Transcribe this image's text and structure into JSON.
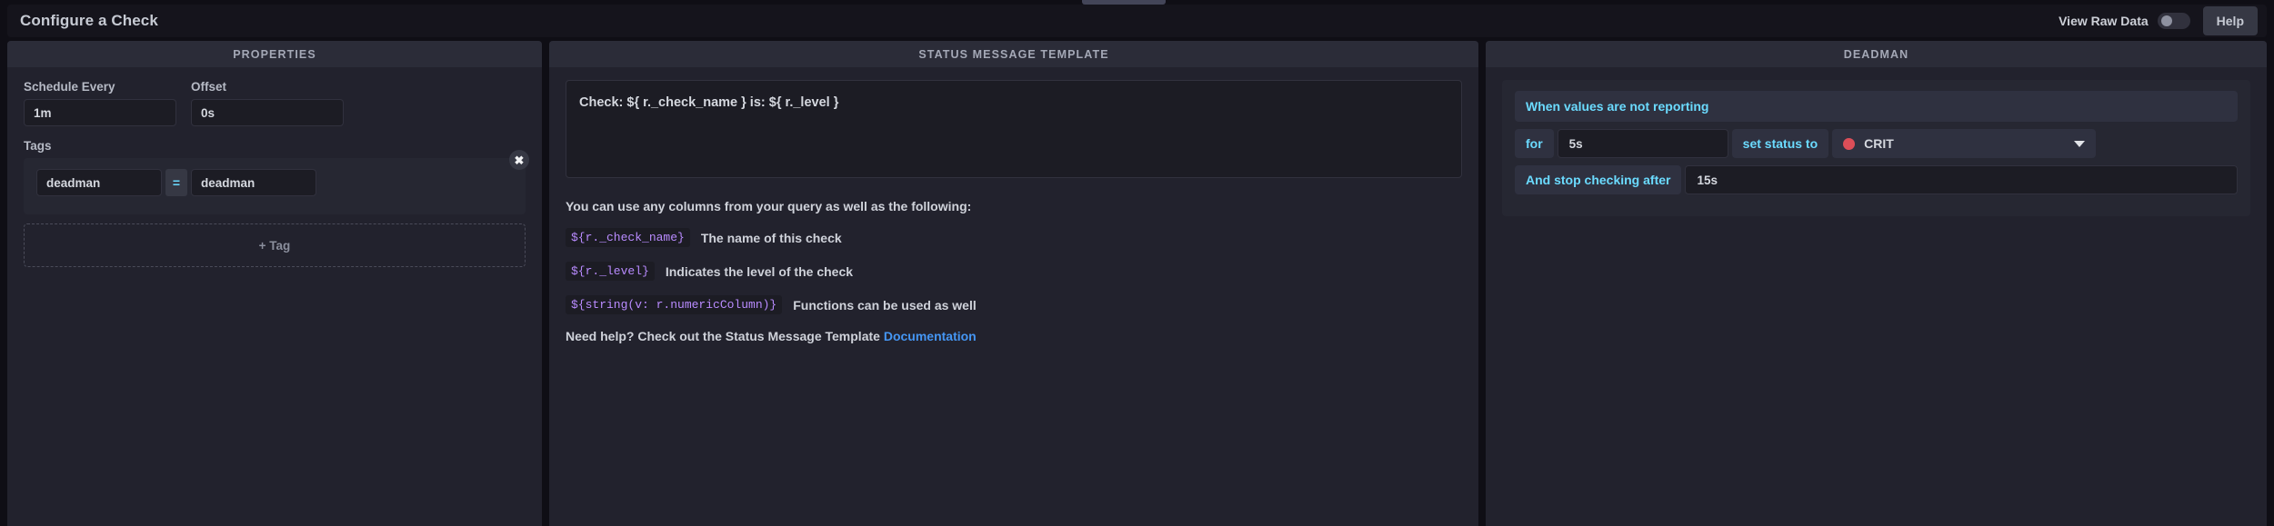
{
  "window": {
    "title": "Configure a Check",
    "drag_handle": "drag-handle"
  },
  "header": {
    "toggle_label": "View Raw Data",
    "toggle_state": "off",
    "help_label": "Help"
  },
  "properties": {
    "panel_title": "PROPERTIES",
    "schedule_label": "Schedule Every",
    "schedule_value": "1m",
    "schedule_placeholder": "1m",
    "offset_label": "Offset",
    "offset_value": "0s",
    "offset_placeholder": "0s",
    "tags_label": "Tags",
    "remove_tag_glyph": "✖",
    "tags": [
      {
        "key": "deadman",
        "key_placeholder": "Key",
        "operator": "=",
        "value": "deadman",
        "value_placeholder": "Value"
      }
    ],
    "add_tag_label": "+ Tag"
  },
  "template": {
    "panel_title": "STATUS MESSAGE TEMPLATE",
    "textarea_value": "Check: ${ r._check_name } is: ${ r._level }",
    "textarea_placeholder": "Example: Check: ${ r._check_name } is: ${ r._level }",
    "help_intro": "You can use any columns from your query as well as the following:",
    "help_rows": [
      {
        "code": "${r._check_name}",
        "desc": "The name of this check"
      },
      {
        "code": "${r._level}",
        "desc": "Indicates the level of the check"
      },
      {
        "code": "${string(v: r.numericColumn)}",
        "desc": "Functions can be used as well"
      }
    ],
    "footer_text": "Need help? Check out the Status Message Template ",
    "footer_link": "Documentation"
  },
  "deadman": {
    "panel_title": "DEADMAN",
    "banner_text": "When values are not reporting",
    "for_label": "for",
    "for_value": "5s",
    "for_placeholder": "5s",
    "set_status_label": "set status to",
    "level_value": "CRIT",
    "level_color": "#dc4e58",
    "stop_label": "And stop checking after",
    "stop_value": "15s",
    "stop_placeholder": "15s"
  },
  "colors": {
    "accent_blue": "#6bdbff",
    "link_blue": "#4596f3",
    "code_purple": "#b98bff",
    "crit_red": "#dc4e58",
    "panel_bg": "#22222d",
    "panel_header_bg": "#2b2c38",
    "app_bg": "#0f0e15"
  }
}
